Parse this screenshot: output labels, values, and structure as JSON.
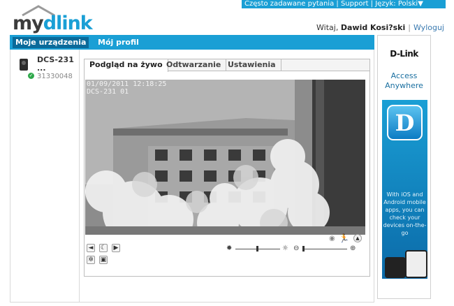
{
  "topbar": {
    "faq": "Często zadawane pytania",
    "support": "Support",
    "language": "Język: Polski▼"
  },
  "logo": {
    "my": "my",
    "dlink": "dlink"
  },
  "greeting": {
    "prefix": "Witaj,",
    "name": "Dawid Kosi?ski",
    "logout": "Wyloguj"
  },
  "nav": {
    "tabs": [
      {
        "label": "Moje urządzenia",
        "active": true
      },
      {
        "label": "Mój profil",
        "active": false
      }
    ]
  },
  "devices": [
    {
      "name": "DCS-231",
      "name2": "...",
      "serial": "31330048",
      "status": "online",
      "icon": "camera-icon"
    }
  ],
  "viewer": {
    "tabs": [
      {
        "label": "Podgląd na żywo",
        "active": true
      },
      {
        "label": "Odtwarzanie",
        "active": false
      },
      {
        "label": "Ustawienia",
        "active": false
      }
    ],
    "timestamp_line1": "01/09/2011 12:18:25",
    "timestamp_line2": "DCS-231 01",
    "controls": {
      "left": [
        "speaker-icon",
        "night-mode-icon",
        "record-icon",
        "settings-icon",
        "snapshot-icon"
      ],
      "right": [
        "motion-icon",
        "expand-icon",
        "brightness-low-icon",
        "brightness-high-icon",
        "zoom-out-icon",
        "zoom-in-icon"
      ],
      "brightness_level": 0.5,
      "zoom_level": 0.0
    }
  },
  "ad": {
    "brand": "D-Link",
    "slogan": "Access Anywhere",
    "icon_letter": "D",
    "body": "With iOS and Android mobile apps, you can check your devices on-the-go"
  },
  "colors": {
    "accent": "#1a9fd5",
    "nav_active": "#0a6a9a",
    "online": "#2ea84a"
  }
}
